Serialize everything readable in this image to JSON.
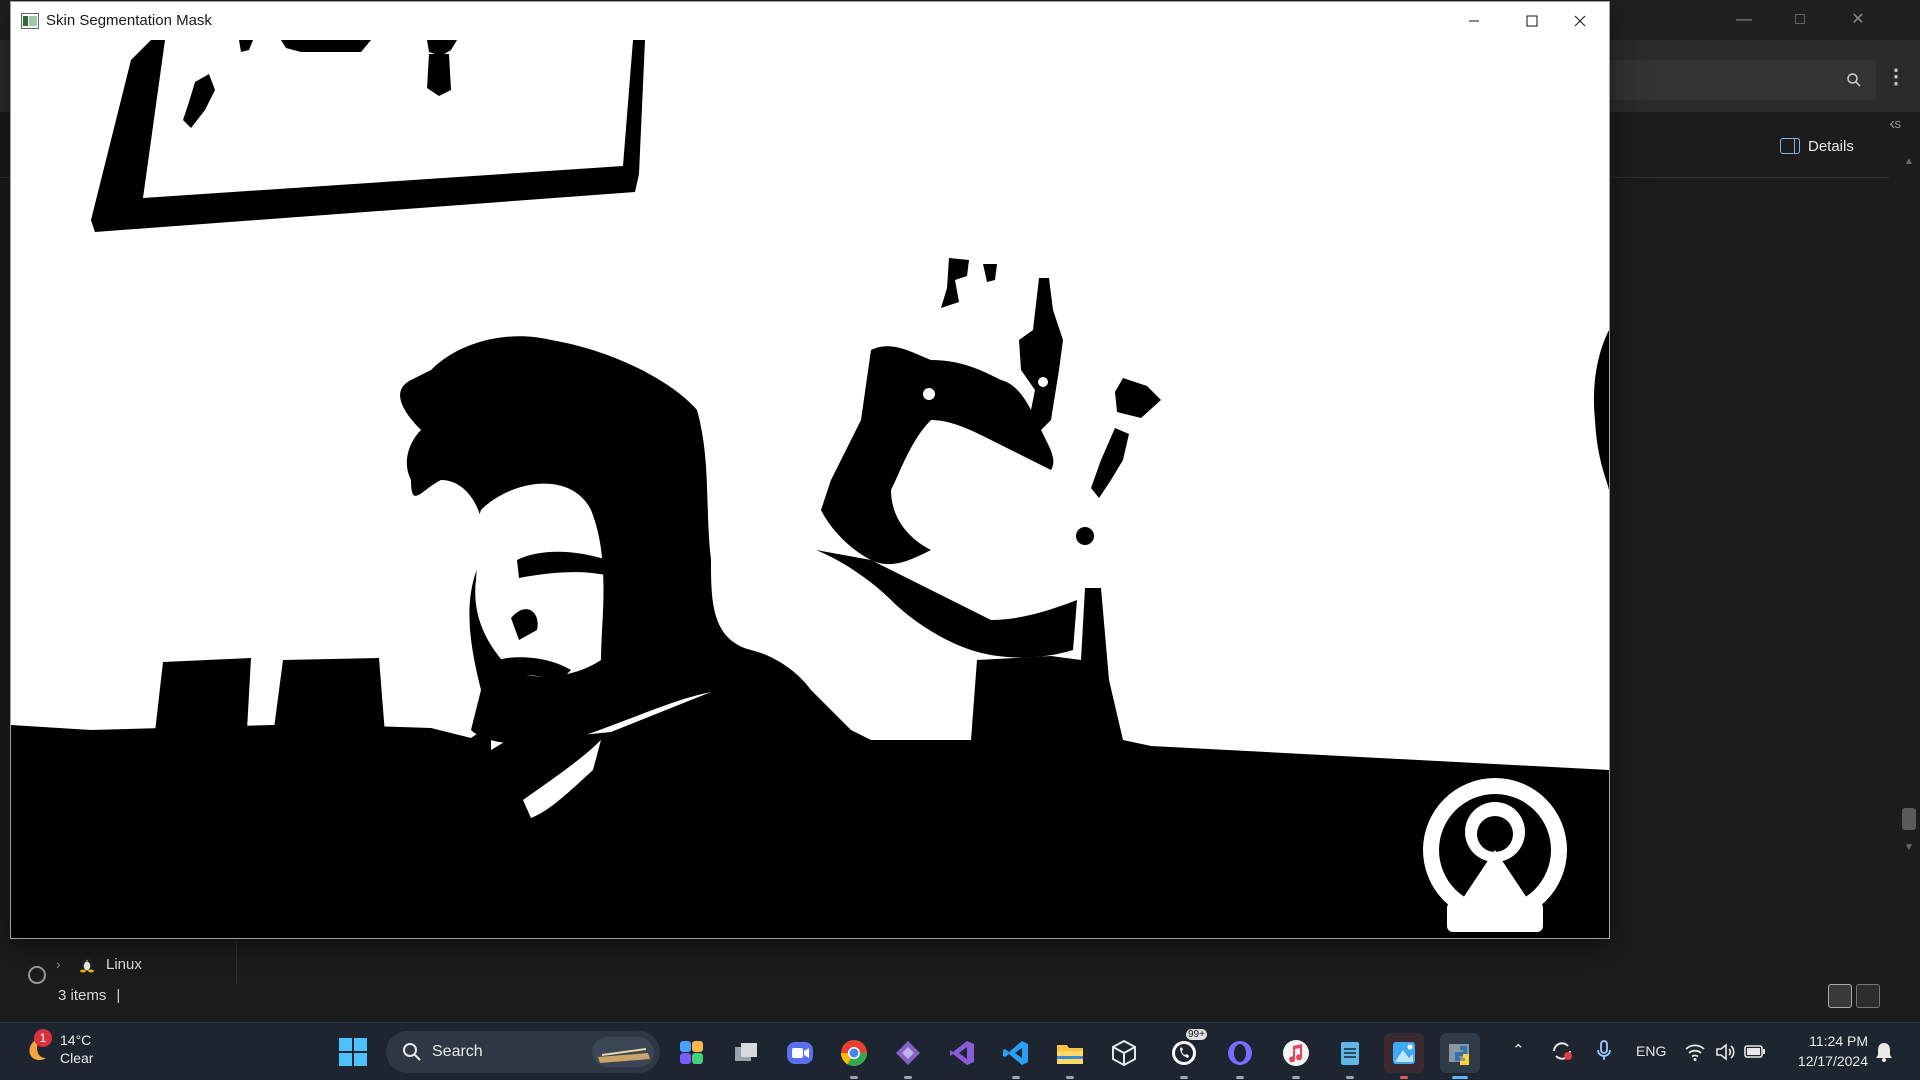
{
  "background_window": {
    "search_placeholder": "",
    "details_label": "Details",
    "edge_text": "ks",
    "tree": [
      {
        "label": "Linux"
      }
    ],
    "status": {
      "items_count": "3 items",
      "separator": "|"
    }
  },
  "cv_window": {
    "title": "Skin Segmentation Mask",
    "controls": {
      "minimize": "minimize-icon",
      "maximize": "maximize-icon",
      "close": "close-icon"
    },
    "canvas": {
      "description_colors": {
        "mask_on": "#000000",
        "mask_off": "#ffffff"
      }
    }
  },
  "taskbar": {
    "weather": {
      "badge": "1",
      "temperature": "14°C",
      "condition": "Clear"
    },
    "search_label": "Search",
    "apps": [
      {
        "name": "copilot-icon"
      },
      {
        "name": "task-view-icon"
      },
      {
        "name": "zoom-icon"
      },
      {
        "name": "chrome-icon"
      },
      {
        "name": "visual-studio-installer-icon"
      },
      {
        "name": "visual-studio-icon"
      },
      {
        "name": "vscode-icon"
      },
      {
        "name": "file-explorer-icon"
      },
      {
        "name": "virtualbox-icon"
      },
      {
        "name": "whatsapp-icon",
        "badge": "99+"
      },
      {
        "name": "opera-gx-icon"
      },
      {
        "name": "itunes-icon"
      },
      {
        "name": "notepad-icon"
      },
      {
        "name": "image-viewer-icon"
      },
      {
        "name": "python-icon"
      }
    ],
    "tray": {
      "language": "ENG"
    },
    "clock": {
      "time": "11:24 PM",
      "date": "12/17/2024"
    }
  },
  "colors": {
    "taskbar_bg": "#1c2530",
    "explorer_bg": "#1c1c1c",
    "accent": "#5fb2ff"
  }
}
